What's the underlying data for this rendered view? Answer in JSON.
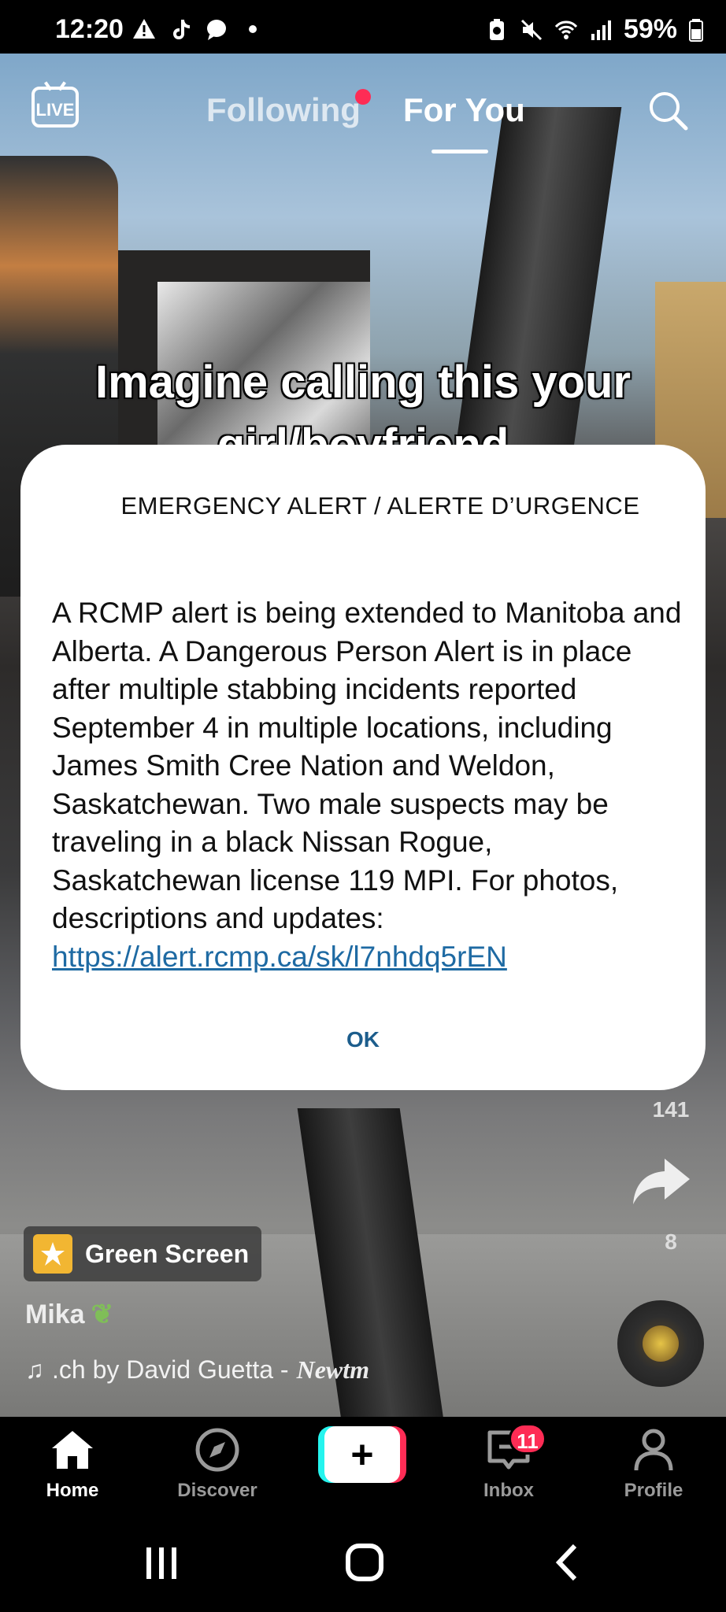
{
  "status_bar": {
    "time": "12:20",
    "battery": "59%",
    "left_icons": [
      "warning-icon",
      "tiktok-icon",
      "messenger-icon",
      "dot-icon"
    ],
    "right_icons": [
      "battery-saver-icon",
      "mute-icon",
      "wifi-icon",
      "signal-icon",
      "battery-icon"
    ]
  },
  "feed": {
    "live_label": "LIVE",
    "tabs": [
      {
        "label": "Following",
        "has_dot": true
      },
      {
        "label": "For You",
        "active": true
      }
    ],
    "caption_line1": "Imagine calling this your",
    "caption_line2": "girl/boyfriend",
    "side_counts": {
      "comments": "141",
      "shares": "8"
    },
    "effect_label": "Green Screen",
    "username": "Mika",
    "music": {
      "text": ".ch by David Guetta - ",
      "strong": "Newtm"
    }
  },
  "alert": {
    "title": "EMERGENCY ALERT / ALERTE D’URGENCE",
    "body": "A RCMP alert is being extended to Manitoba and Alberta. A Dangerous Person Alert is in place after multiple stabbing incidents reported September 4 in multiple locations, including James Smith Cree Nation and Weldon, Saskatchewan. Two male suspects may be traveling in a black Nissan Rogue, Saskatchewan license 119 MPI. For photos, descriptions and updates:",
    "link": "https://alert.rcmp.ca/sk/l7nhdq5rEN",
    "ok_label": "OK"
  },
  "bottom_nav": {
    "items": [
      {
        "label": "Home",
        "icon": "home-icon",
        "active": true
      },
      {
        "label": "Discover",
        "icon": "compass-icon"
      },
      {
        "label": "",
        "icon": "plus-icon"
      },
      {
        "label": "Inbox",
        "icon": "inbox-icon",
        "badge": "11"
      },
      {
        "label": "Profile",
        "icon": "profile-icon"
      }
    ]
  },
  "colors": {
    "accent": "#fe2c55",
    "cyan": "#25f4ee",
    "link": "#1e6aa3"
  }
}
